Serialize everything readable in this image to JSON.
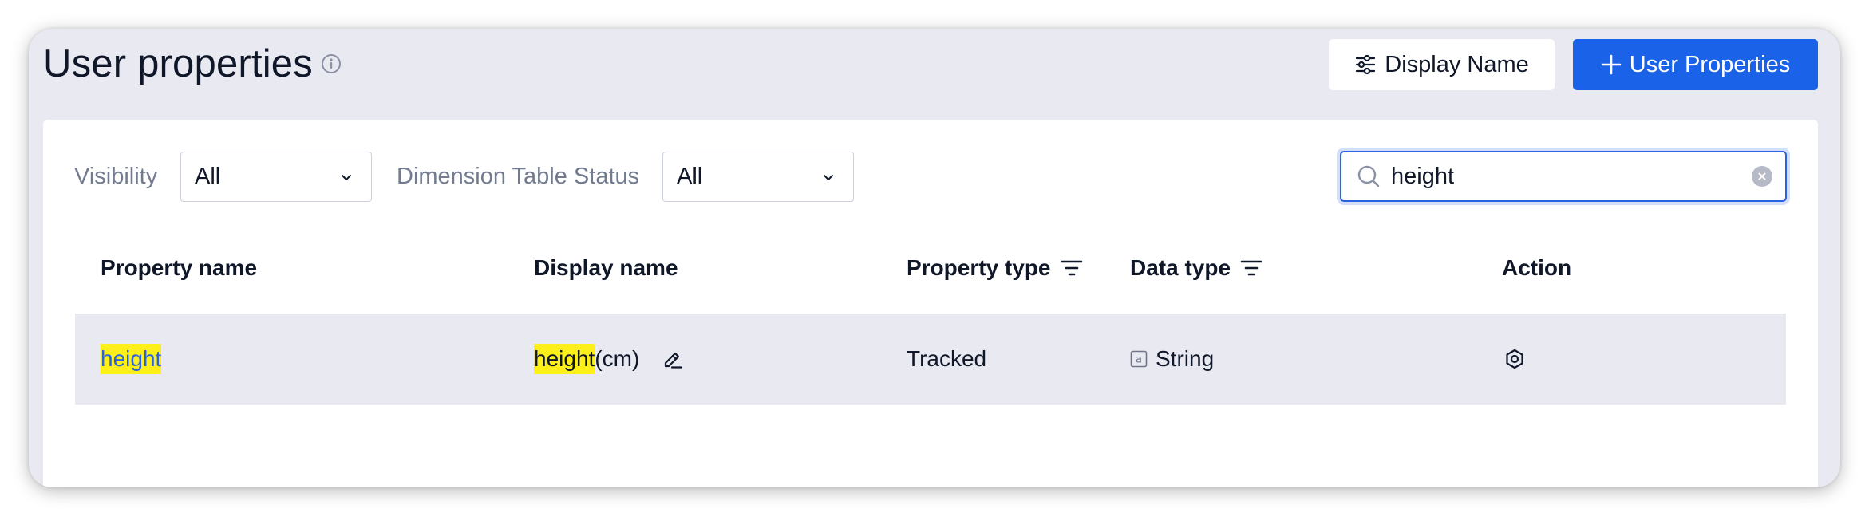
{
  "header": {
    "title": "User properties",
    "display_name_button": "Display Name",
    "add_button": "User Properties"
  },
  "filters": {
    "visibility_label": "Visibility",
    "visibility_value": "All",
    "dimension_label": "Dimension Table Status",
    "dimension_value": "All"
  },
  "search": {
    "value": "height"
  },
  "table": {
    "columns": {
      "property_name": "Property name",
      "display_name": "Display name",
      "property_type": "Property type",
      "data_type": "Data type",
      "action": "Action"
    },
    "rows": [
      {
        "property_name": "height",
        "display_name_match": "height",
        "display_name_rest": "(cm)",
        "property_type": "Tracked",
        "data_type": "String"
      }
    ]
  },
  "colors": {
    "primary": "#1a62e8",
    "highlight": "#fdef1a",
    "link": "#2a63df",
    "background": "#e8e9f1"
  },
  "icons": {
    "title": "info-icon",
    "display_name_button": "sliders-icon",
    "add_button": "plus-icon",
    "search": "search-icon",
    "clear": "clear-icon",
    "filter": "filter-icon",
    "edit": "edit-icon",
    "data_type": "string-type-icon",
    "action": "settings-icon"
  }
}
